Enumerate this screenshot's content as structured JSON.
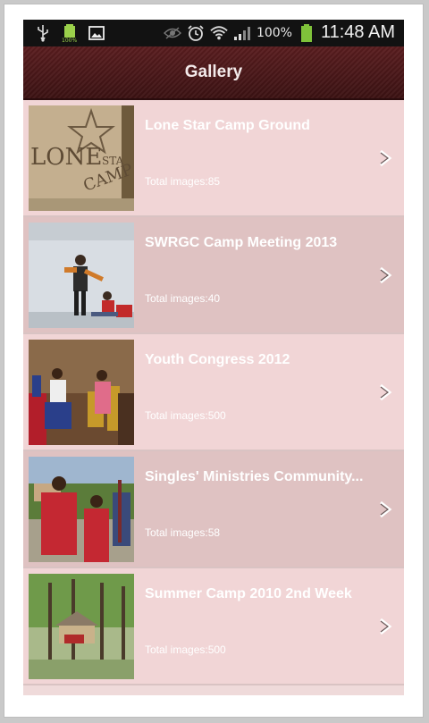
{
  "status_bar": {
    "battery_percent": "100%",
    "time": "11:48 AM",
    "small_battery_label": "100%",
    "icons": [
      "usb-icon",
      "battery-charging-icon",
      "image-icon",
      "eye-icon",
      "alarm-icon",
      "wifi-icon",
      "signal-icon",
      "battery-icon"
    ]
  },
  "header": {
    "title": "Gallery"
  },
  "gallery": {
    "items": [
      {
        "title": "Lone Star Camp Ground",
        "count": "Total images:85"
      },
      {
        "title": "SWRGC Camp Meeting 2013",
        "count": "Total images:40"
      },
      {
        "title": "Youth Congress 2012",
        "count": "Total images:500"
      },
      {
        "title": "Singles' Ministries Community...",
        "count": "Total images:58"
      },
      {
        "title": "Summer Camp 2010 2nd Week",
        "count": "Total images:500"
      }
    ]
  },
  "colors": {
    "header_bg": "#4a1718",
    "row_light": "#f1d5d6",
    "row_dark": "#dfc2c2",
    "status_bg": "#121212"
  }
}
